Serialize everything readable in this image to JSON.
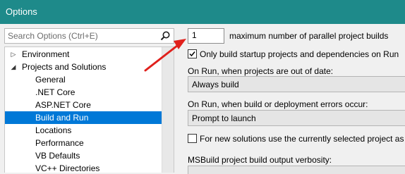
{
  "window": {
    "title": "Options"
  },
  "search": {
    "placeholder": "Search Options (Ctrl+E)",
    "icon": "search-icon"
  },
  "tree": {
    "items": [
      {
        "label": "Environment",
        "level": 0,
        "arrow": "▷"
      },
      {
        "label": "Projects and Solutions",
        "level": 0,
        "arrow": "◢"
      },
      {
        "label": "General",
        "level": 1
      },
      {
        "label": ".NET Core",
        "level": 1
      },
      {
        "label": "ASP.NET Core",
        "level": 1
      },
      {
        "label": "Build and Run",
        "level": 1,
        "selected": true
      },
      {
        "label": "Locations",
        "level": 1
      },
      {
        "label": "Performance",
        "level": 1
      },
      {
        "label": "VB Defaults",
        "level": 1
      },
      {
        "label": "VC++ Directories",
        "level": 1
      }
    ]
  },
  "settings": {
    "parallel_builds": {
      "value": "1",
      "label": "maximum number of parallel project builds"
    },
    "only_startup": {
      "checked": true,
      "label": "Only build startup projects and dependencies on Run"
    },
    "out_of_date": {
      "label": "On Run, when projects are out of date:",
      "value": "Always build"
    },
    "build_errors": {
      "label": "On Run, when build or deployment errors occur:",
      "value": "Prompt to launch"
    },
    "new_solutions": {
      "checked": false,
      "label": "For new solutions use the currently selected project as th"
    },
    "verbosity": {
      "label": "MSBuild project build output verbosity:"
    }
  },
  "colors": {
    "accent": "#1e8a8a",
    "selection": "#0078d7",
    "annotation": "#e0201c"
  }
}
